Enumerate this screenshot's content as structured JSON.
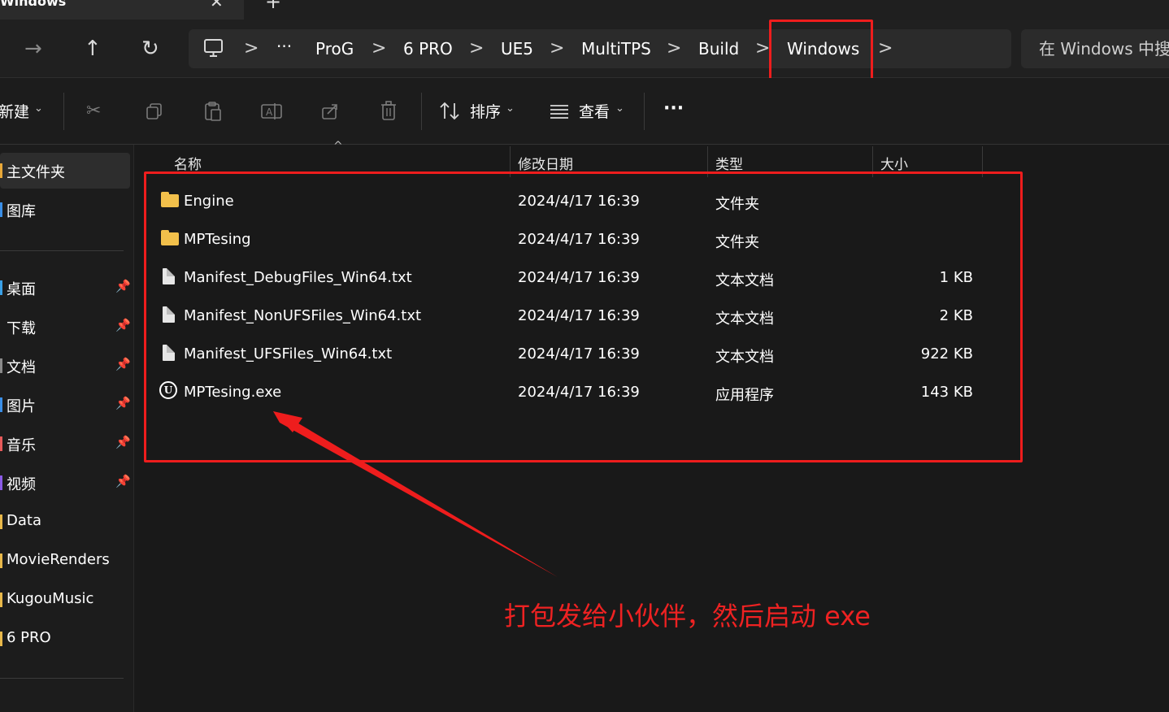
{
  "window": {
    "tab_title": "Windows",
    "close_glyph": "✕",
    "newtab_glyph": "+"
  },
  "nav": {
    "forward_glyph": "→",
    "up_glyph": "↑",
    "refresh_glyph": "↻",
    "breadcrumb": {
      "more": "···",
      "items": [
        "ProG",
        "6 PRO",
        "UE5",
        "MultiTPS",
        "Build",
        "Windows"
      ],
      "separator": ">"
    },
    "search_placeholder": "在 Windows 中搜"
  },
  "commandbar": {
    "new_label": "新建",
    "sort_label": "排序",
    "view_label": "查看",
    "more_glyph": "···",
    "icons": [
      "cut-icon",
      "copy-icon",
      "paste-icon",
      "rename-icon",
      "share-icon",
      "delete-icon"
    ]
  },
  "sidebar": {
    "top_items": [
      {
        "label": "主文件夹",
        "selected": true,
        "color": "#e8a838"
      },
      {
        "label": "图库",
        "color": "#3a8ee6"
      }
    ],
    "pinned": [
      {
        "label": "桌面",
        "color": "#3aa0e6"
      },
      {
        "label": "下载",
        "color": "#3aa06a"
      },
      {
        "label": "文档",
        "color": "#8a8a8a"
      },
      {
        "label": "图片",
        "color": "#3a8ee6"
      },
      {
        "label": "音乐",
        "color": "#e65a5a"
      },
      {
        "label": "视频",
        "color": "#8a5ae6"
      }
    ],
    "folders": [
      {
        "label": "Data"
      },
      {
        "label": "MovieRenders"
      },
      {
        "label": "KugouMusic"
      },
      {
        "label": "6 PRO"
      }
    ]
  },
  "filelist": {
    "columns": {
      "name": "名称",
      "modified": "修改日期",
      "type": "类型",
      "size": "大小"
    },
    "rows": [
      {
        "name": "Engine",
        "modified": "2024/4/17 16:39",
        "type": "文件夹",
        "size": "",
        "icon": "folder-icon"
      },
      {
        "name": "MPTesing",
        "modified": "2024/4/17 16:39",
        "type": "文件夹",
        "size": "",
        "icon": "folder-icon"
      },
      {
        "name": "Manifest_DebugFiles_Win64.txt",
        "modified": "2024/4/17 16:39",
        "type": "文本文档",
        "size": "1 KB",
        "icon": "text-file-icon"
      },
      {
        "name": "Manifest_NonUFSFiles_Win64.txt",
        "modified": "2024/4/17 16:39",
        "type": "文本文档",
        "size": "2 KB",
        "icon": "text-file-icon"
      },
      {
        "name": "Manifest_UFSFiles_Win64.txt",
        "modified": "2024/4/17 16:39",
        "type": "文本文档",
        "size": "922 KB",
        "icon": "text-file-icon"
      },
      {
        "name": "MPTesing.exe",
        "modified": "2024/4/17 16:39",
        "type": "应用程序",
        "size": "143 KB",
        "icon": "unreal-engine-icon"
      }
    ]
  },
  "annotation": {
    "text": "打包发给小伙伴，然后启动 exe",
    "color": "#ee2222"
  }
}
